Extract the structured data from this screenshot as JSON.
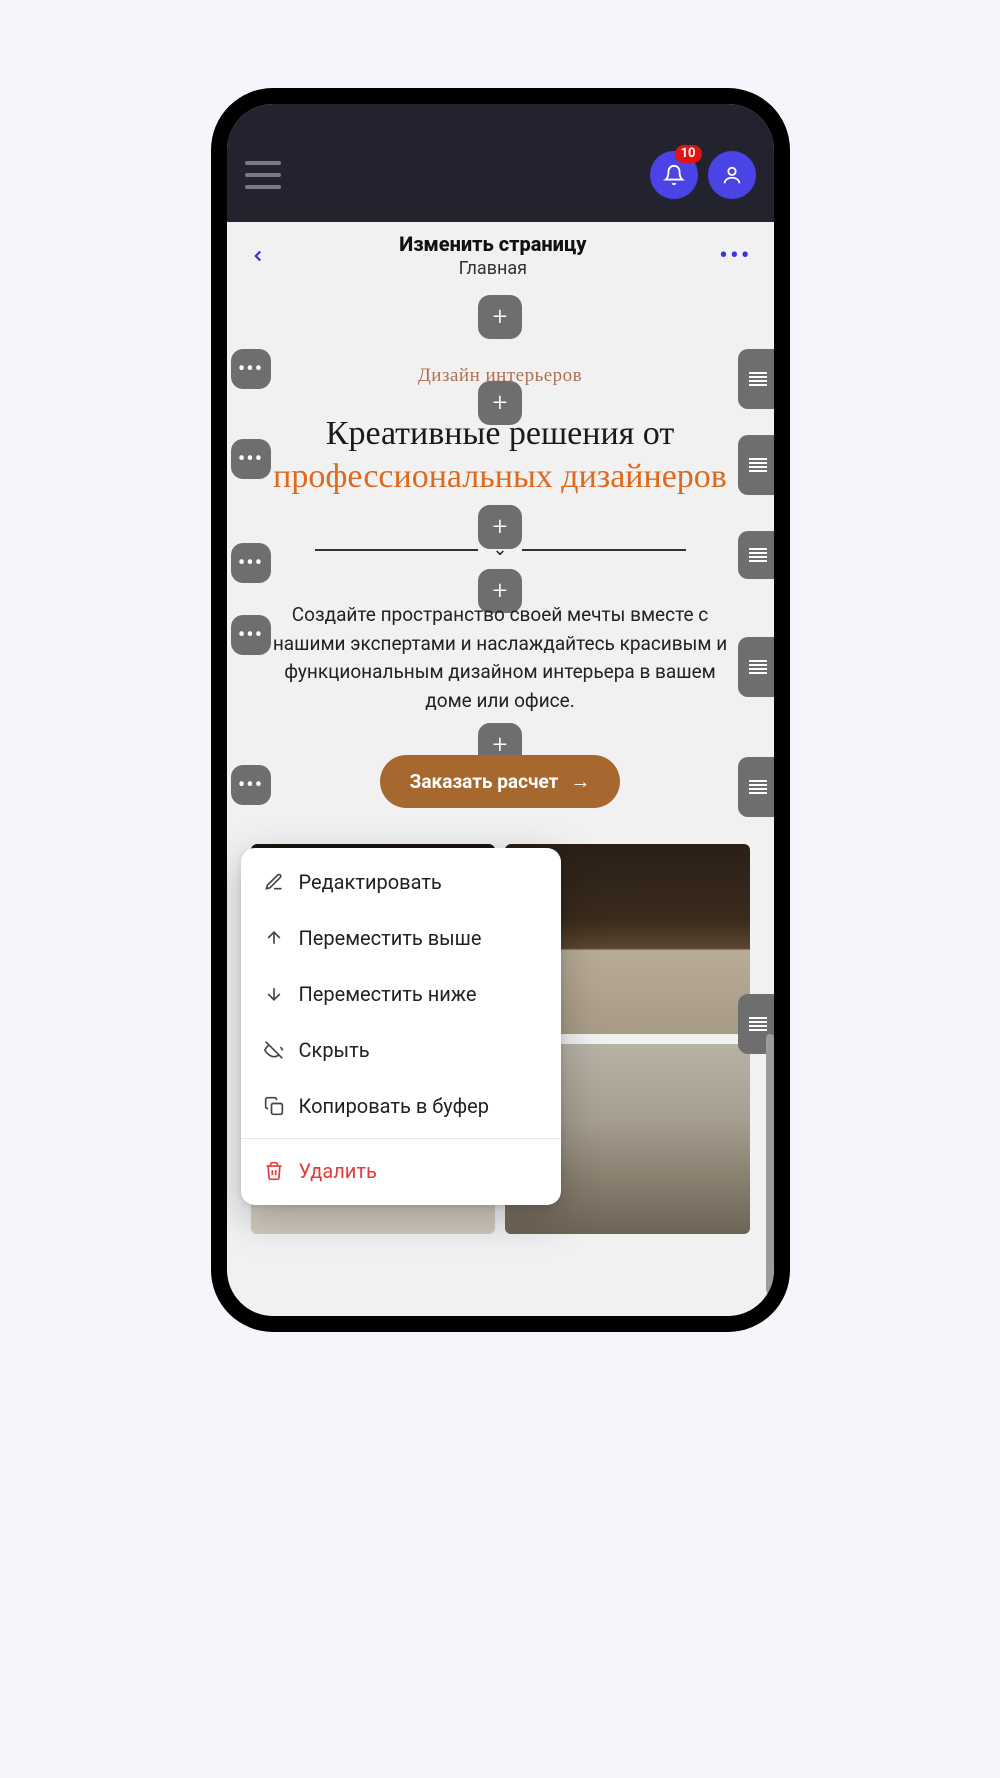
{
  "appbar": {
    "notification_count": "10"
  },
  "subheader": {
    "title": "Изменить страницу",
    "subtitle": "Главная"
  },
  "hero": {
    "eyebrow": "Дизайн интерьеров",
    "title_line1": "Креативные решения от",
    "title_line2": "профессиональных дизайнеров",
    "paragraph": "Создайте пространство своей мечты вместе с нашими экспертами и наслаждайтесь красивым и функциональным дизайном интерьера в вашем доме или офисе.",
    "cta_label": "Заказать расчет"
  },
  "context_menu": {
    "edit": "Редактировать",
    "move_up": "Переместить выше",
    "move_down": "Переместить ниже",
    "hide": "Скрыть",
    "copy": "Копировать в буфер",
    "delete": "Удалить"
  }
}
